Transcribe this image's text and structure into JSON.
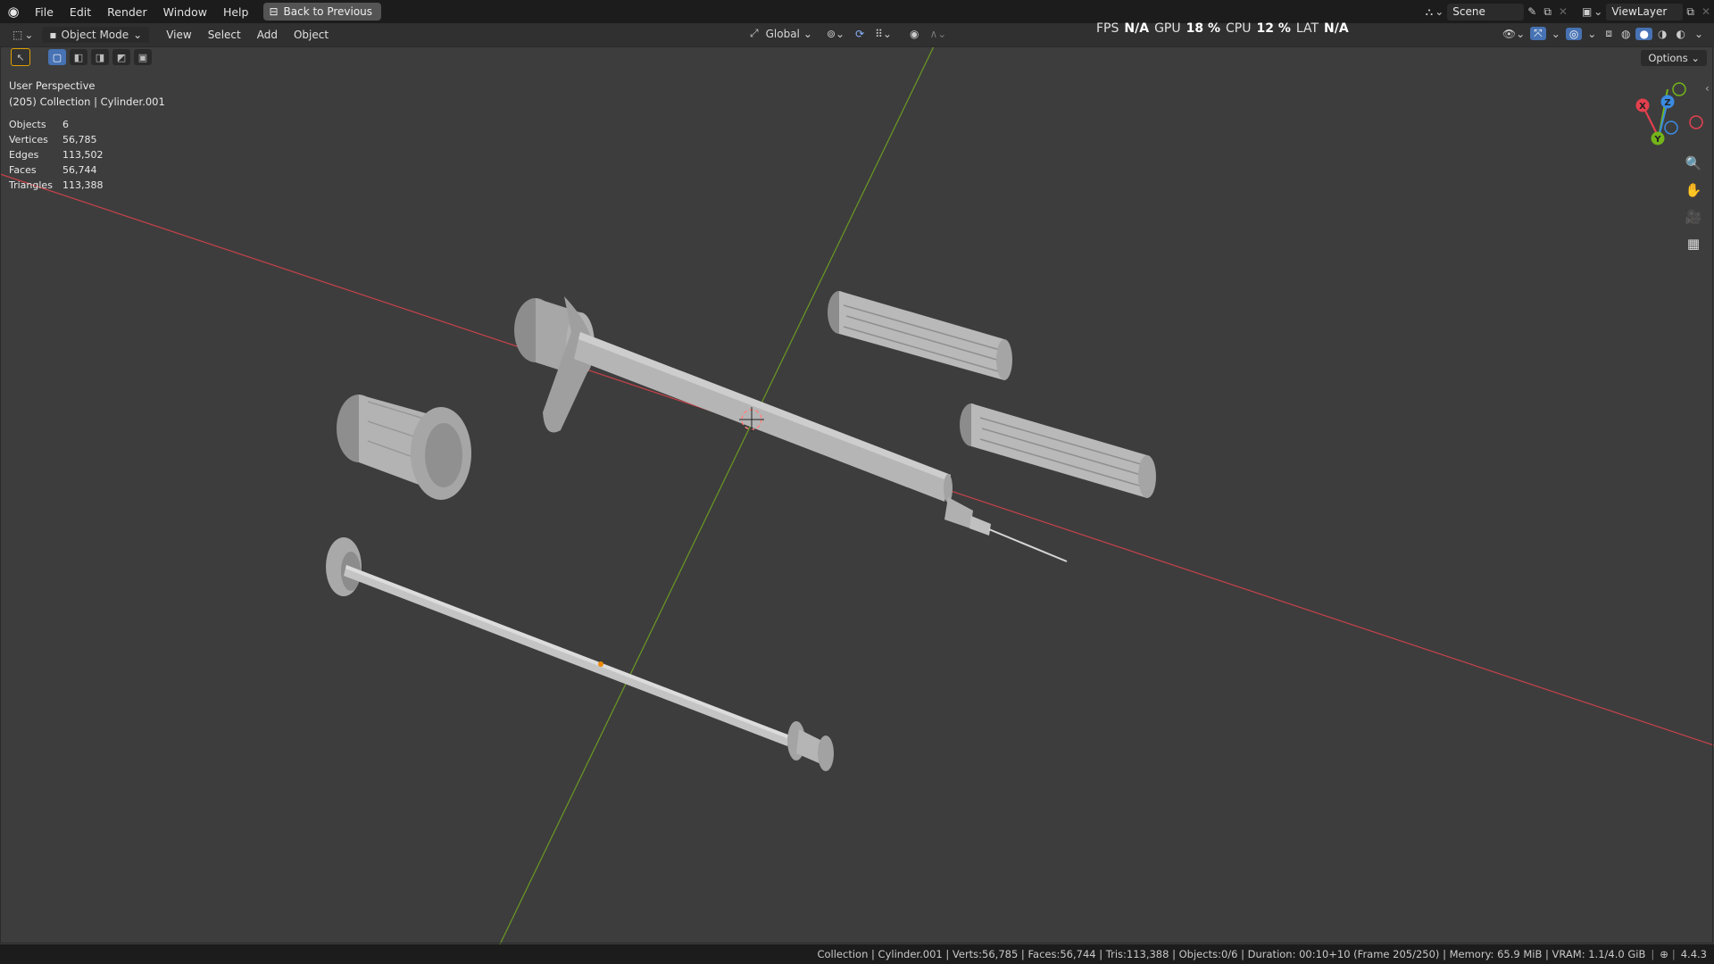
{
  "menu": {
    "file": "File",
    "edit": "Edit",
    "render": "Render",
    "window": "Window",
    "help": "Help",
    "back": "Back to Previous"
  },
  "scene": "Scene",
  "view_layer": "ViewLayer",
  "header": {
    "mode": "Object Mode",
    "view": "View",
    "select": "Select",
    "add": "Add",
    "object": "Object",
    "orientation": "Global",
    "options": "Options"
  },
  "perf": {
    "fps_label": "FPS",
    "fps": "N/A",
    "gpu_label": "GPU",
    "gpu": "18 %",
    "cpu_label": "CPU",
    "cpu": "12 %",
    "lat_label": "LAT",
    "lat": "N/A"
  },
  "overlay": {
    "perspective": "User Perspective",
    "collection": "(205) Collection | Cylinder.001"
  },
  "stats": [
    {
      "label": "Objects",
      "value": "6"
    },
    {
      "label": "Vertices",
      "value": "56,785"
    },
    {
      "label": "Edges",
      "value": "113,502"
    },
    {
      "label": "Faces",
      "value": "56,744"
    },
    {
      "label": "Triangles",
      "value": "113,388"
    }
  ],
  "gizmo": {
    "x": "X",
    "y": "Y",
    "z": "Z"
  },
  "statusbar": "Collection | Cylinder.001 | Verts:56,785 | Faces:56,744 | Tris:113,388 | Objects:0/6 | Duration: 00:10+10 (Frame 205/250) | Memory: 65.9 MiB | VRAM: 1.1/4.0 GiB",
  "version": "4.4.3",
  "colors": {
    "x_axis": "#c8434a",
    "y_axis": "#6a9a22",
    "z_gizmo": "#3b8be0",
    "y_gizmo": "#74b41a",
    "x_gizmo": "#e3404e",
    "active": "#4772b3"
  }
}
